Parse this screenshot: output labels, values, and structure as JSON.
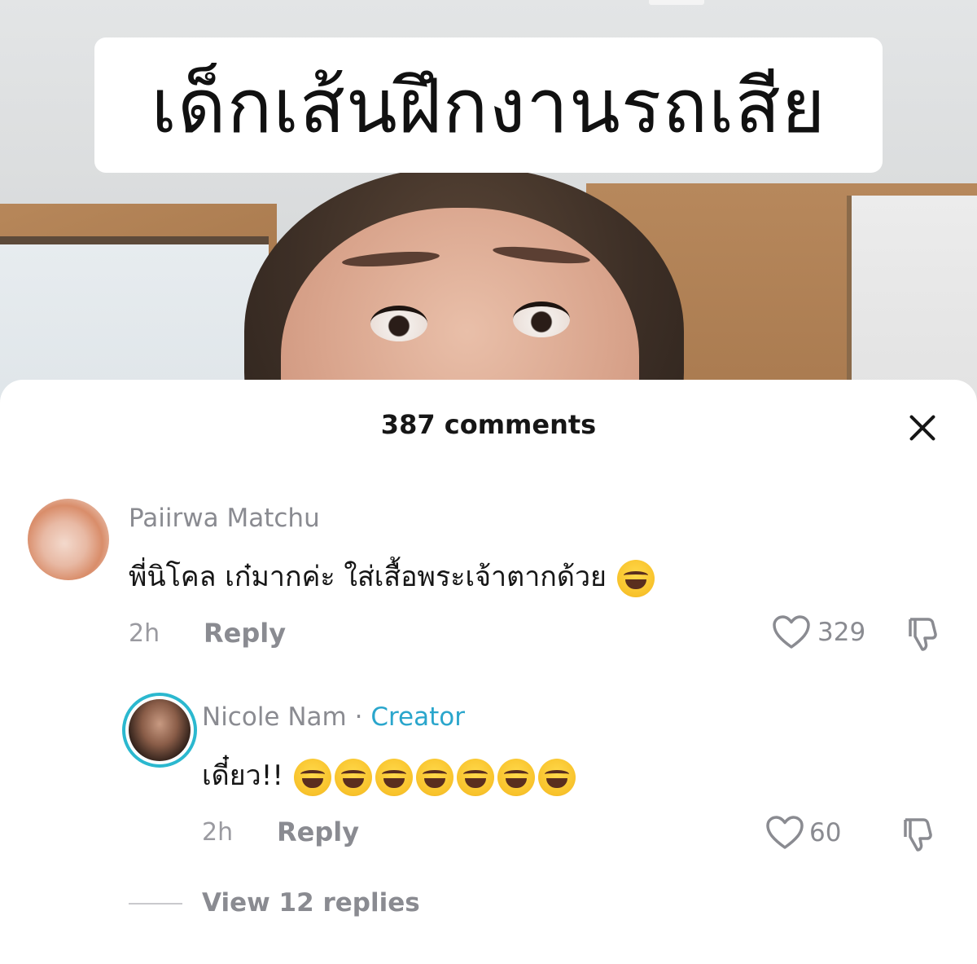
{
  "video": {
    "caption": "เด็กเส้นฝึกงานรถเสีย"
  },
  "sheet": {
    "title": "387 comments"
  },
  "comments": [
    {
      "username": "Paiirwa Matchu",
      "text": "พี่นิโคล เก๋มากค่ะ ใส่เสื้อพระเจ้าตากด้วย",
      "emoji_count": 1,
      "time": "2h",
      "reply_label": "Reply",
      "likes": "329"
    },
    {
      "username": "Nicole Nam",
      "separator": "·",
      "badge": "Creator",
      "text": "เดี๋ยว!!",
      "emoji_count": 7,
      "time": "2h",
      "reply_label": "Reply",
      "likes": "60"
    }
  ],
  "view_replies": "View 12 replies",
  "colors": {
    "creator_accent": "#2aa6cc",
    "muted_text": "#8a8b91"
  }
}
